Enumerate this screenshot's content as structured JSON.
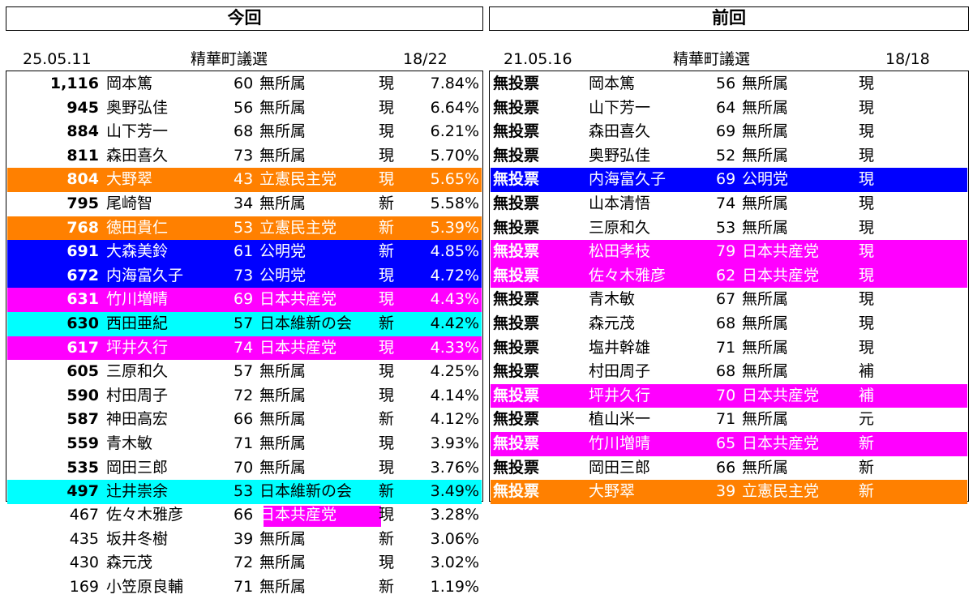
{
  "headers": {
    "current": "今回",
    "previous": "前回"
  },
  "current": {
    "date": "25.05.11",
    "title": "精華町議選",
    "seats": "18/22",
    "rows": [
      {
        "votes": "1,116",
        "name": "岡本篤",
        "age": "60",
        "party": "無所属",
        "status": "現",
        "pct": "7.84%",
        "color": ""
      },
      {
        "votes": "945",
        "name": "奥野弘佳",
        "age": "56",
        "party": "無所属",
        "status": "現",
        "pct": "6.64%",
        "color": ""
      },
      {
        "votes": "884",
        "name": "山下芳一",
        "age": "68",
        "party": "無所属",
        "status": "現",
        "pct": "6.21%",
        "color": ""
      },
      {
        "votes": "811",
        "name": "森田喜久",
        "age": "73",
        "party": "無所属",
        "status": "現",
        "pct": "5.70%",
        "color": ""
      },
      {
        "votes": "804",
        "name": "大野翠",
        "age": "43",
        "party": "立憲民主党",
        "status": "現",
        "pct": "5.65%",
        "color": "#ff8000"
      },
      {
        "votes": "795",
        "name": "尾崎智",
        "age": "34",
        "party": "無所属",
        "status": "新",
        "pct": "5.58%",
        "color": ""
      },
      {
        "votes": "768",
        "name": "徳田貴仁",
        "age": "53",
        "party": "立憲民主党",
        "status": "新",
        "pct": "5.39%",
        "color": "#ff8000"
      },
      {
        "votes": "691",
        "name": "大森美鈴",
        "age": "61",
        "party": "公明党",
        "status": "新",
        "pct": "4.85%",
        "color": "#0000ff"
      },
      {
        "votes": "672",
        "name": "内海富久子",
        "age": "73",
        "party": "公明党",
        "status": "現",
        "pct": "4.72%",
        "color": "#0000ff"
      },
      {
        "votes": "631",
        "name": "竹川増晴",
        "age": "69",
        "party": "日本共産党",
        "status": "現",
        "pct": "4.43%",
        "color": "#ff00ff"
      },
      {
        "votes": "630",
        "name": "西田亜紀",
        "age": "57",
        "party": "日本維新の会",
        "status": "新",
        "pct": "4.42%",
        "color": "#00ffff"
      },
      {
        "votes": "617",
        "name": "坪井久行",
        "age": "74",
        "party": "日本共産党",
        "status": "現",
        "pct": "4.33%",
        "color": "#ff00ff"
      },
      {
        "votes": "605",
        "name": "三原和久",
        "age": "57",
        "party": "無所属",
        "status": "現",
        "pct": "4.25%",
        "color": ""
      },
      {
        "votes": "590",
        "name": "村田周子",
        "age": "72",
        "party": "無所属",
        "status": "現",
        "pct": "4.14%",
        "color": ""
      },
      {
        "votes": "587",
        "name": "神田高宏",
        "age": "66",
        "party": "無所属",
        "status": "新",
        "pct": "4.12%",
        "color": ""
      },
      {
        "votes": "559",
        "name": "青木敏",
        "age": "71",
        "party": "無所属",
        "status": "現",
        "pct": "3.93%",
        "color": ""
      },
      {
        "votes": "535",
        "name": "岡田三郎",
        "age": "70",
        "party": "無所属",
        "status": "現",
        "pct": "3.76%",
        "color": ""
      },
      {
        "votes": "497",
        "name": "辻井崇余",
        "age": "53",
        "party": "日本維新の会",
        "status": "新",
        "pct": "3.49%",
        "color": "#00ffff"
      }
    ],
    "losers": [
      {
        "votes": "467",
        "name": "佐々木雅彦",
        "age": "66",
        "party": "日本共産党",
        "status": "現",
        "pct": "3.28%",
        "party_color": "#ff00ff"
      },
      {
        "votes": "435",
        "name": "坂井冬樹",
        "age": "39",
        "party": "無所属",
        "status": "新",
        "pct": "3.06%",
        "party_color": ""
      },
      {
        "votes": "430",
        "name": "森元茂",
        "age": "72",
        "party": "無所属",
        "status": "現",
        "pct": "3.02%",
        "party_color": ""
      },
      {
        "votes": "169",
        "name": "小笠原良輔",
        "age": "71",
        "party": "無所属",
        "status": "新",
        "pct": "1.19%",
        "party_color": ""
      }
    ]
  },
  "previous": {
    "date": "21.05.16",
    "title": "精華町議選",
    "seats": "18/18",
    "rows": [
      {
        "votes": "無投票",
        "name": "岡本篤",
        "age": "56",
        "party": "無所属",
        "status": "現",
        "color": ""
      },
      {
        "votes": "無投票",
        "name": "山下芳一",
        "age": "64",
        "party": "無所属",
        "status": "現",
        "color": ""
      },
      {
        "votes": "無投票",
        "name": "森田喜久",
        "age": "69",
        "party": "無所属",
        "status": "現",
        "color": ""
      },
      {
        "votes": "無投票",
        "name": "奥野弘佳",
        "age": "52",
        "party": "無所属",
        "status": "現",
        "color": ""
      },
      {
        "votes": "無投票",
        "name": "内海富久子",
        "age": "69",
        "party": "公明党",
        "status": "現",
        "color": "#0000ff"
      },
      {
        "votes": "無投票",
        "name": "山本清悟",
        "age": "74",
        "party": "無所属",
        "status": "現",
        "color": ""
      },
      {
        "votes": "無投票",
        "name": "三原和久",
        "age": "53",
        "party": "無所属",
        "status": "現",
        "color": ""
      },
      {
        "votes": "無投票",
        "name": "松田孝枝",
        "age": "79",
        "party": "日本共産党",
        "status": "現",
        "color": "#ff00ff"
      },
      {
        "votes": "無投票",
        "name": "佐々木雅彦",
        "age": "62",
        "party": "日本共産党",
        "status": "現",
        "color": "#ff00ff"
      },
      {
        "votes": "無投票",
        "name": "青木敏",
        "age": "67",
        "party": "無所属",
        "status": "現",
        "color": ""
      },
      {
        "votes": "無投票",
        "name": "森元茂",
        "age": "68",
        "party": "無所属",
        "status": "現",
        "color": ""
      },
      {
        "votes": "無投票",
        "name": "塩井幹雄",
        "age": "71",
        "party": "無所属",
        "status": "現",
        "color": ""
      },
      {
        "votes": "無投票",
        "name": "村田周子",
        "age": "68",
        "party": "無所属",
        "status": "補",
        "color": ""
      },
      {
        "votes": "無投票",
        "name": "坪井久行",
        "age": "70",
        "party": "日本共産党",
        "status": "補",
        "color": "#ff00ff"
      },
      {
        "votes": "無投票",
        "name": "植山米一",
        "age": "71",
        "party": "無所属",
        "status": "元",
        "color": ""
      },
      {
        "votes": "無投票",
        "name": "竹川増晴",
        "age": "65",
        "party": "日本共産党",
        "status": "新",
        "color": "#ff00ff"
      },
      {
        "votes": "無投票",
        "name": "岡田三郎",
        "age": "66",
        "party": "無所属",
        "status": "新",
        "color": ""
      },
      {
        "votes": "無投票",
        "name": "大野翠",
        "age": "39",
        "party": "立憲民主党",
        "status": "新",
        "color": "#ff8000"
      }
    ]
  }
}
